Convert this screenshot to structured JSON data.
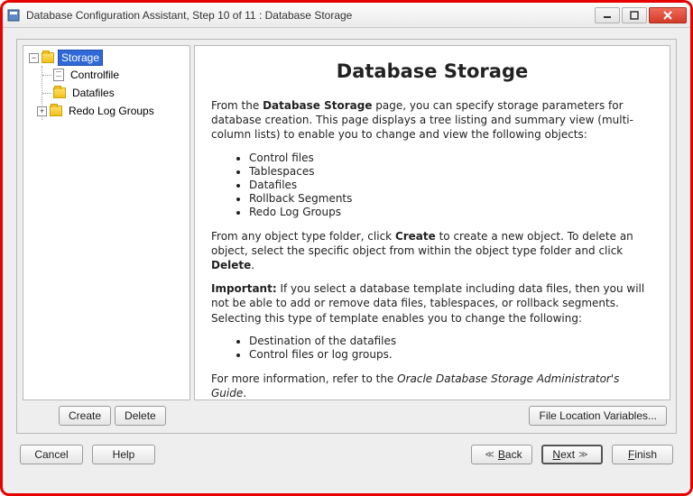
{
  "window": {
    "title": "Database Configuration Assistant, Step 10 of 11 : Database Storage"
  },
  "tree": {
    "root": "Storage",
    "children": {
      "controlfile": "Controlfile",
      "datafiles": "Datafiles",
      "redolog": "Redo Log Groups"
    }
  },
  "info": {
    "heading": "Database Storage",
    "p1_pre": "From the ",
    "p1_bold": "Database Storage",
    "p1_post": " page, you can specify storage parameters for database creation. This page displays a tree listing and summary view (multi-column lists) to enable you to change and view the following objects:",
    "list1": {
      "i1": "Control files",
      "i2": "Tablespaces",
      "i3": "Datafiles",
      "i4": "Rollback Segments",
      "i5": "Redo Log Groups"
    },
    "p2_pre": "From any object type folder, click ",
    "p2_b1": "Create",
    "p2_mid": " to create a new object. To delete an object, select the specific object from within the object type folder and click ",
    "p2_b2": "Delete",
    "p2_post": ".",
    "p3_b": "Important:",
    "p3_post": " If you select a database template including data files, then you will not be able to add or remove data files, tablespaces, or rollback segments. Selecting this type of template enables you to change the following:",
    "list2": {
      "i1": "Destination of the datafiles",
      "i2": "Control files or log groups."
    },
    "p4_pre": "For more information, refer to the ",
    "p4_em": "Oracle Database Storage Administrator's Guide",
    "p4_post": "."
  },
  "frameButtons": {
    "create": "Create",
    "delete": "Delete",
    "fileloc": "File Location Variables..."
  },
  "wizard": {
    "cancel": "Cancel",
    "help": "Help",
    "back": "Back",
    "next": "Next",
    "finish": "Finish"
  }
}
